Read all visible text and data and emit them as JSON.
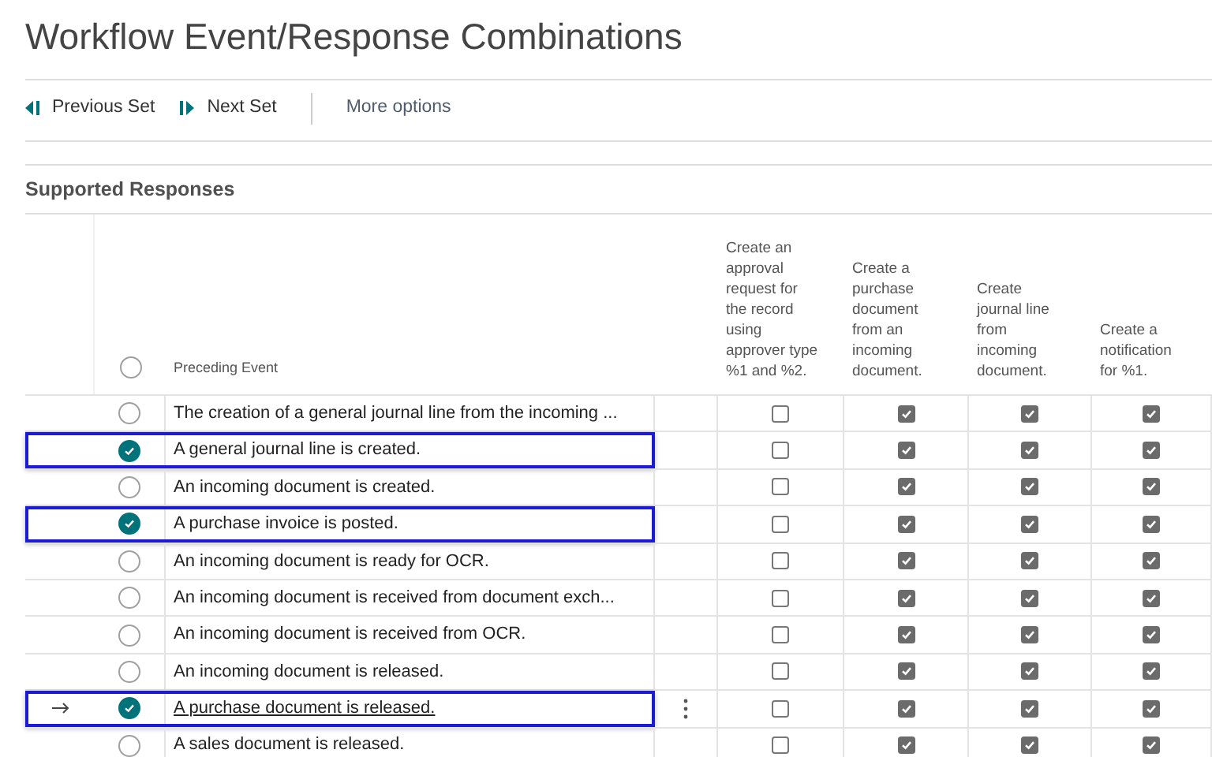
{
  "title": "Workflow Event/Response Combinations",
  "toolbar": [
    {
      "kind": "previous",
      "label": "Previous Set"
    },
    {
      "kind": "next",
      "label": "Next Set"
    },
    {
      "kind": "more",
      "label": "More options"
    }
  ],
  "section_title": "Supported Responses",
  "table": {
    "select_all": {
      "selected": false
    },
    "event_column": "Preceding Event",
    "response_columns": [
      "Create an approval request for the record using approver type %1 and %2.",
      "Create a purchase document from an incoming document.",
      "Create journal line from incoming document.",
      "Create a notification for %1."
    ],
    "rows": [
      {
        "event": "The creation of a general journal line from the incoming ...",
        "selected": false,
        "current": false,
        "responses": [
          false,
          true,
          true,
          true
        ]
      },
      {
        "event": "A general journal line is created.",
        "selected": true,
        "current": false,
        "responses": [
          false,
          true,
          true,
          true
        ]
      },
      {
        "event": "An incoming document is created.",
        "selected": false,
        "current": false,
        "responses": [
          false,
          true,
          true,
          true
        ]
      },
      {
        "event": "A purchase invoice is posted.",
        "selected": true,
        "current": false,
        "responses": [
          false,
          true,
          true,
          true
        ]
      },
      {
        "event": "An incoming document is ready for OCR.",
        "selected": false,
        "current": false,
        "responses": [
          false,
          true,
          true,
          true
        ]
      },
      {
        "event": "An incoming document is received from document exch...",
        "selected": false,
        "current": false,
        "responses": [
          false,
          true,
          true,
          true
        ]
      },
      {
        "event": "An incoming document is received from OCR.",
        "selected": false,
        "current": false,
        "responses": [
          false,
          true,
          true,
          true
        ]
      },
      {
        "event": "An incoming document is released.",
        "selected": false,
        "current": false,
        "responses": [
          false,
          true,
          true,
          true
        ]
      },
      {
        "event": "A purchase document is released.",
        "selected": true,
        "current": true,
        "responses": [
          false,
          true,
          true,
          true
        ]
      },
      {
        "event": "A sales document is released.",
        "selected": false,
        "current": false,
        "responses": [
          false,
          true,
          true,
          true
        ]
      }
    ]
  }
}
